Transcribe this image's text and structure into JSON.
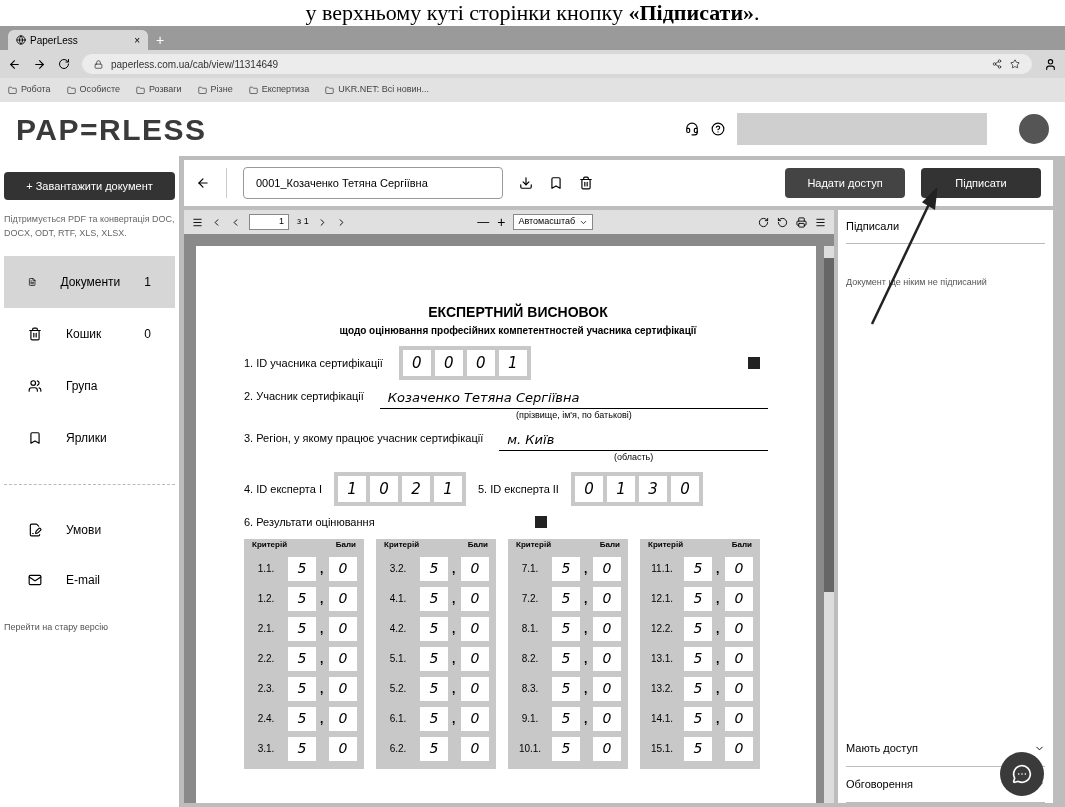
{
  "caption": "у верхньому куті сторінки кнопку **«Підписати»**.",
  "browser": {
    "tab_title": "PaperLess",
    "tab_close": "×",
    "new_tab": "+",
    "url": "paperless.com.ua/cab/view/11314649",
    "bookmarks": [
      "Робота",
      "Особисте",
      "Розваги",
      "Різне",
      "Експертиза",
      "UKR.NET: Всі новин..."
    ]
  },
  "app": {
    "logo": "PAP=RLESS"
  },
  "sidebar": {
    "upload_button": "+ Завантажити документ",
    "hint": "Підтримується PDF та конвертація DOC, DOCX, ODT, RTF, XLS, XLSX.",
    "nav": [
      {
        "label": "Документи",
        "count": "1",
        "selected": true
      },
      {
        "label": "Кошик",
        "count": "0",
        "selected": false
      },
      {
        "label": "Група",
        "selected": false
      },
      {
        "label": "Ярлики",
        "selected": false
      }
    ],
    "extra": [
      {
        "label": "Умови"
      },
      {
        "label": "E-mail"
      }
    ],
    "old_version_link": "Перейти на стару версію"
  },
  "toolbar": {
    "document_name": "0001_Козаченко Тетяна Сергіївна",
    "share_button": "Надати доступ",
    "sign_button": "Підписати"
  },
  "viewer": {
    "page_input": "1",
    "page_count": "з 1",
    "zoom_select": "Автомасштаб",
    "minus": "—",
    "plus": "+"
  },
  "document": {
    "title": "ЕКСПЕРТНИЙ ВИСНОВОК",
    "subtitle": "щодо оцінювання професійних компетентностей учасника сертифікації",
    "participant_id_label": "1. ID учасника сертифікації",
    "participant_id": [
      "0",
      "0",
      "0",
      "1"
    ],
    "participant_label": "2. Учасник сертифікації",
    "participant_name": "Козаченко Тетяна Сергіївна",
    "participant_hint": "(прізвище, ім'я, по батькові)",
    "region_label": "3. Регіон, у якому працює учасник сертифікації",
    "region": "м. Київ",
    "region_hint": "(область)",
    "expert1_label": "4. ID експерта І",
    "expert1_id": [
      "1",
      "0",
      "2",
      "1"
    ],
    "expert2_label": "5. ID експерта ІІ",
    "expert2_id": [
      "0",
      "1",
      "3",
      "0"
    ],
    "results_label": "6. Результати оцінювання",
    "score_columns": [
      {
        "header": [
          "Критерій",
          "Бали"
        ],
        "rows": [
          {
            "criterion": "1.1.",
            "score": [
              "5",
              "0"
            ],
            "comma": ","
          },
          {
            "criterion": "1.2.",
            "score": [
              "5",
              "0"
            ],
            "comma": ","
          },
          {
            "criterion": "2.1.",
            "score": [
              "5",
              "0"
            ],
            "comma": ","
          },
          {
            "criterion": "2.2.",
            "score": [
              "5",
              "0"
            ],
            "comma": ","
          },
          {
            "criterion": "2.3.",
            "score": [
              "5",
              "0"
            ],
            "comma": ","
          },
          {
            "criterion": "2.4.",
            "score": [
              "5",
              "0"
            ],
            "comma": ","
          },
          {
            "criterion": "3.1.",
            "score": [
              "5",
              "0"
            ]
          }
        ]
      },
      {
        "header": [
          "Критерій",
          "Бали"
        ],
        "rows": [
          {
            "criterion": "3.2.",
            "score": [
              "5",
              "0"
            ],
            "comma": ","
          },
          {
            "criterion": "4.1.",
            "score": [
              "5",
              "0"
            ],
            "comma": ","
          },
          {
            "criterion": "4.2.",
            "score": [
              "5",
              "0"
            ],
            "comma": ","
          },
          {
            "criterion": "5.1.",
            "score": [
              "5",
              "0"
            ],
            "comma": ","
          },
          {
            "criterion": "5.2.",
            "score": [
              "5",
              "0"
            ],
            "comma": ","
          },
          {
            "criterion": "6.1.",
            "score": [
              "5",
              "0"
            ],
            "comma": ","
          },
          {
            "criterion": "6.2.",
            "score": [
              "5",
              "0"
            ]
          }
        ]
      },
      {
        "header": [
          "Критерій",
          "Бали"
        ],
        "rows": [
          {
            "criterion": "7.1.",
            "score": [
              "5",
              "0"
            ],
            "comma": ","
          },
          {
            "criterion": "7.2.",
            "score": [
              "5",
              "0"
            ],
            "comma": ","
          },
          {
            "criterion": "8.1.",
            "score": [
              "5",
              "0"
            ],
            "comma": ","
          },
          {
            "criterion": "8.2.",
            "score": [
              "5",
              "0"
            ],
            "comma": ","
          },
          {
            "criterion": "8.3.",
            "score": [
              "5",
              "0"
            ],
            "comma": ","
          },
          {
            "criterion": "9.1.",
            "score": [
              "5",
              "0"
            ],
            "comma": ","
          },
          {
            "criterion": "10.1.",
            "score": [
              "5",
              "0"
            ]
          }
        ]
      },
      {
        "header": [
          "Критерій",
          "Бали"
        ],
        "rows": [
          {
            "criterion": "11.1.",
            "score": [
              "5",
              "0"
            ],
            "comma": ","
          },
          {
            "criterion": "12.1.",
            "score": [
              "5",
              "0"
            ],
            "comma": ","
          },
          {
            "criterion": "12.2.",
            "score": [
              "5",
              "0"
            ],
            "comma": ","
          },
          {
            "criterion": "13.1.",
            "score": [
              "5",
              "0"
            ],
            "comma": ","
          },
          {
            "criterion": "13.2.",
            "score": [
              "5",
              "0"
            ],
            "comma": ","
          },
          {
            "criterion": "14.1.",
            "score": [
              "5",
              "0"
            ],
            "comma": ","
          },
          {
            "criterion": "15.1.",
            "score": [
              "5",
              "0"
            ]
          }
        ]
      }
    ]
  },
  "side_panel": {
    "title": "Підписали",
    "empty_text": "Документ ще ніким не підписаний",
    "sections": [
      {
        "label": "Мають доступ",
        "expanded": false
      },
      {
        "label": "Обговорення",
        "expanded": false
      }
    ]
  }
}
